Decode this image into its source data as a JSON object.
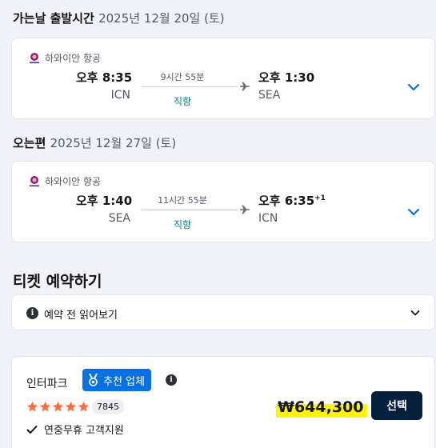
{
  "outbound": {
    "title": "가는날 출발시간",
    "date": "2025년 12월 20일 (토)",
    "airline": "하와이안 항공",
    "dep_time": "오후 8:35",
    "dep_code": "ICN",
    "duration": "9시간 55분",
    "stops": "직항",
    "arr_time": "오후 1:30",
    "arr_code": "SEA"
  },
  "inbound": {
    "title": "오는편",
    "date": "2025년 12월 27일 (토)",
    "airline": "하와이안 항공",
    "dep_time": "오후 1:40",
    "dep_code": "SEA",
    "duration": "11시간 55분",
    "stops": "직항",
    "arr_time": "오후 6:35",
    "arr_day_offset": "+1",
    "arr_code": "ICN"
  },
  "booking": {
    "title": "티켓 예약하기",
    "notice": "예약 전 읽어보기"
  },
  "provider": {
    "name": "인터파크",
    "badge": "추천 업체",
    "rating": 5,
    "review_count": "7845",
    "feature": "연중무휴 고객지원",
    "price": "₩644,300",
    "select_label": "선택"
  },
  "colors": {
    "accent_blue": "#0770e3",
    "dark_navy": "#05203c",
    "teal": "#0c7d7a",
    "star": "#ff6b3d",
    "price_highlight": "#fff500"
  }
}
